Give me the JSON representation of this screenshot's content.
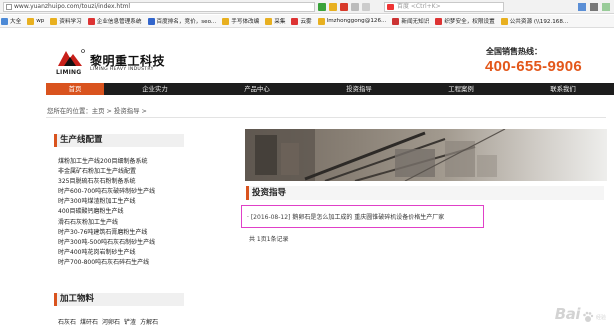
{
  "browser": {
    "url": "www.yuanzhuipo.com/touzi/index.html",
    "search_placeholder": "百度 <Ctrl+K>",
    "bookmarks": [
      "大全",
      "wp",
      "资料学习",
      "企业信息管理系统",
      "百度排名，竞价，seo...",
      "手写体改编",
      "采集",
      "云雾",
      "lmzhonggong@126...",
      "新闻无知识",
      "织梦安全，权限设置",
      "公共资源 (\\\\192.168..."
    ]
  },
  "header": {
    "logo_en": "LIMING",
    "logo_cn": "黎明重工科技",
    "logo_sub": "LIMING HEAVY INDUSTRY",
    "hotline_label": "全国销售热线：",
    "hotline_number": "400-655-9906"
  },
  "nav": [
    "首页",
    "企业实力",
    "产品中心",
    "投资指导",
    "工程案例",
    "联系我们"
  ],
  "breadcrumb": "您所在的位置：主页 > 投资指导 >",
  "sidebar": {
    "section1_title": "生产线配置",
    "items": [
      "煤粉加工生产线200目细制备系统",
      "非金属矿石粉加工生产线配置",
      "325目脱硫石灰石粉制备系统",
      "时产600-700吨石灰破碎制砂生产线",
      "时产300吨煤渣粉加工生产线",
      "400目碳酸钙磨粉生产线",
      "滑石石灰粉加工生产线",
      "时产30-76吨建筑石膏磨粉生产线",
      "时产300吨-500吨石灰石制砂生产线",
      "时产400吨花岗岩制砂生产线",
      "时产700-800吨石灰石碎石生产线"
    ],
    "section2_title": "加工物料",
    "materials": [
      "石灰石",
      "煤矸石",
      "河卵石",
      "铲渣",
      "方解石"
    ]
  },
  "content": {
    "section_title": "投资指导",
    "article_bullet": "·",
    "article_date": "[2016-08-12]",
    "article_title": "鹅卵石是怎么加工成的 重庆圆锥破碎机设备价格生产厂家",
    "pager": "共 1页1条记录"
  },
  "watermark": {
    "logo": "Bai",
    "sub": "经验"
  }
}
